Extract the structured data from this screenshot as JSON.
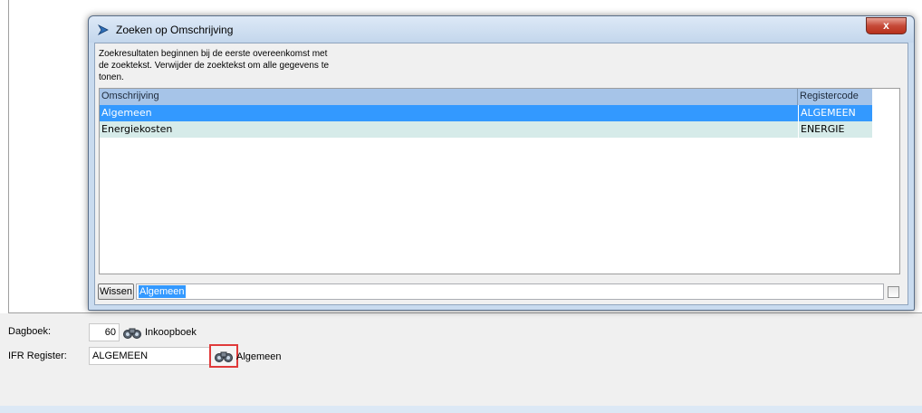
{
  "dialog": {
    "title": "Zoeken op Omschrijving",
    "close_label": "x",
    "info_text": "Zoekresultaten beginnen bij de eerste overeenkomst met de zoektekst. Verwijder de zoektekst om alle gegevens te tonen.",
    "columns": [
      "Omschrijving",
      "Registercode"
    ],
    "rows": [
      {
        "omschrijving": "Algemeen",
        "registercode": "ALGEMEEN",
        "selected": true
      },
      {
        "omschrijving": "Energiekosten",
        "registercode": "ENERGIE",
        "selected": false
      }
    ],
    "wissen_label": "Wissen",
    "search_value": "Algemeen"
  },
  "form": {
    "dagboek_label": "Dagboek:",
    "dagboek_value": "60",
    "dagboek_name": "Inkoopboek",
    "ifr_label": "IFR Register:",
    "ifr_value": "ALGEMEEN",
    "ifr_name": "Algemeen"
  },
  "colors": {
    "selection": "#3399ff",
    "alt_row": "#d6ebe9",
    "header": "#a6c4e8",
    "highlight_border": "#e03a3a"
  },
  "icons": {
    "title": "dialog-arrow-icon",
    "lookup": "binoculars-icon"
  }
}
